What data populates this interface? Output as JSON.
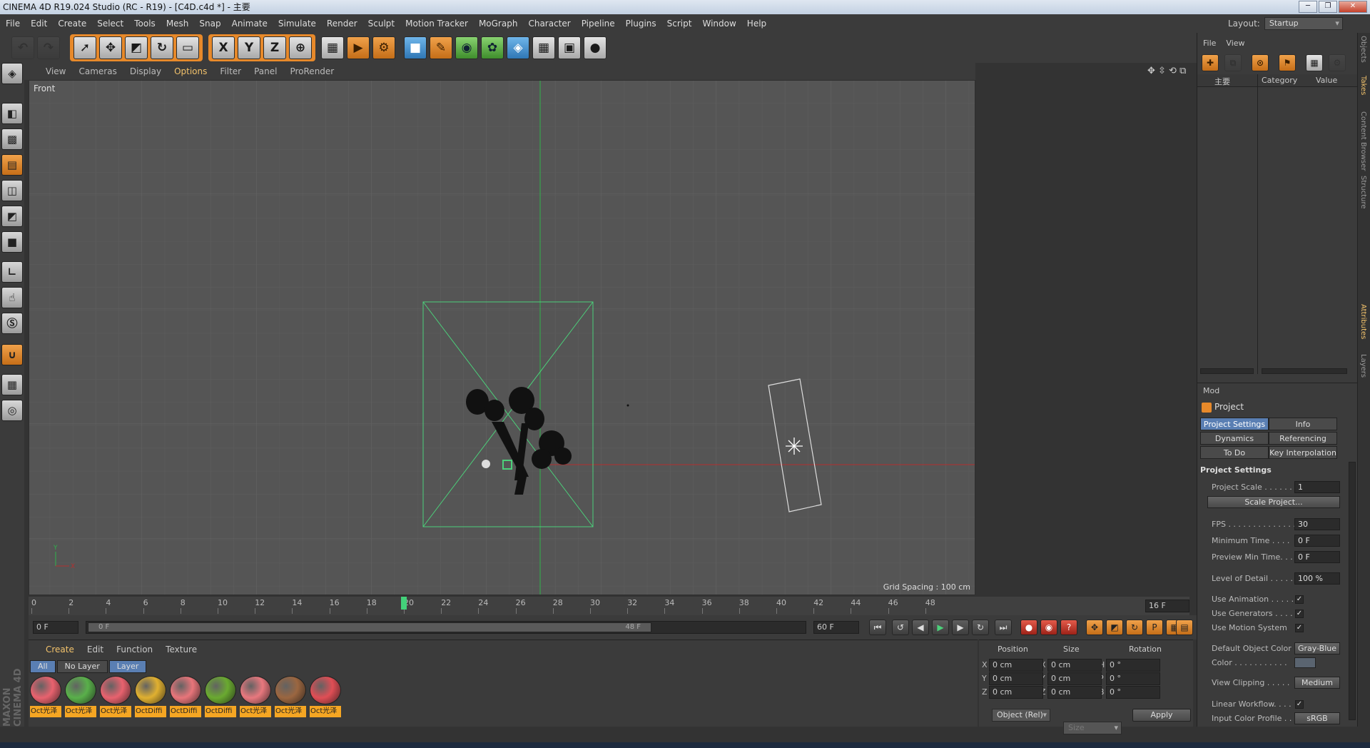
{
  "window": {
    "title": "CINEMA 4D R19.024 Studio (RC - R19) - [C4D.c4d *] - 主要"
  },
  "menu": [
    "File",
    "Edit",
    "Create",
    "Select",
    "Tools",
    "Mesh",
    "Snap",
    "Animate",
    "Simulate",
    "Render",
    "Sculpt",
    "Motion Tracker",
    "MoGraph",
    "Character",
    "Pipeline",
    "Plugins",
    "Script",
    "Window",
    "Help"
  ],
  "layout": {
    "label": "Layout:",
    "value": "Startup"
  },
  "toolbar": {
    "x_label": "X",
    "y_label": "Y",
    "z_label": "Z"
  },
  "viewport_menu": [
    "View",
    "Cameras",
    "Display",
    "Options",
    "Filter",
    "Panel",
    "ProRender"
  ],
  "viewport_active_menu": "Options",
  "viewport": {
    "name": "Front",
    "grid_spacing": "Grid Spacing : 100 cm"
  },
  "timeline": {
    "ticks": [
      "0",
      "2",
      "4",
      "6",
      "8",
      "10",
      "12",
      "14",
      "16",
      "18",
      "20",
      "22",
      "24",
      "26",
      "28",
      "30",
      "32",
      "34",
      "36",
      "38",
      "40",
      "42",
      "44",
      "46",
      "48"
    ],
    "current_frame": "16 F"
  },
  "transport": {
    "start": "0 F",
    "range_start": "0 F",
    "range_end": "48 F",
    "end": "60 F"
  },
  "material_manager": {
    "menu": [
      "Create",
      "Edit",
      "Function",
      "Texture"
    ],
    "filters": [
      "All",
      "No Layer",
      "Layer"
    ],
    "materials": [
      {
        "label": "Oct光泽",
        "color": "#e8626e"
      },
      {
        "label": "Oct光泽",
        "color": "#59b04a"
      },
      {
        "label": "Oct光泽",
        "color": "#e8626e"
      },
      {
        "label": "OctDiffi",
        "color": "#e0b030"
      },
      {
        "label": "OctDiffi",
        "color": "#e8757a"
      },
      {
        "label": "OctDiffi",
        "color": "#6aaa30"
      },
      {
        "label": "Oct光泽",
        "color": "#e8787e"
      },
      {
        "label": "Oct光泽",
        "color": "#9b6640"
      },
      {
        "label": "Oct光泽",
        "color": "#e04e55"
      }
    ]
  },
  "coordinates": {
    "headers": [
      "Position",
      "Size",
      "Rotation"
    ],
    "rows": [
      {
        "ax": "X",
        "pos": "0 cm",
        "sax": "X",
        "size": "0 cm",
        "rax": "H",
        "rot": "0 °"
      },
      {
        "ax": "Y",
        "pos": "0 cm",
        "sax": "Y",
        "size": "0 cm",
        "rax": "P",
        "rot": "0 °"
      },
      {
        "ax": "Z",
        "pos": "0 cm",
        "sax": "Z",
        "size": "0 cm",
        "rax": "B",
        "rot": "0 °"
      }
    ],
    "mode": "Object (Rel)",
    "size_mode": "Size",
    "apply": "Apply"
  },
  "object_manager": {
    "menu": [
      "File",
      "View"
    ],
    "columns": [
      "主要",
      "Category",
      "Value"
    ]
  },
  "attributes": {
    "mode": "Mod",
    "object": "Project",
    "tabs": [
      "Project Settings",
      "Info",
      "Dynamics",
      "Referencing",
      "To Do",
      "Key Interpolation"
    ],
    "section": "Project Settings",
    "project_scale": {
      "label": "Project Scale . . . . . .",
      "value": "1"
    },
    "scale_button": "Scale Project...",
    "fps": {
      "label": "FPS . . . . . . . . . . . . . . .",
      "value": "30"
    },
    "min_time": {
      "label": "Minimum Time . . . .",
      "value": "0 F"
    },
    "preview_min": {
      "label": "Preview Min Time. . .",
      "value": "0 F"
    },
    "lod": {
      "label": "Level of Detail . . . . .",
      "value": "100 %"
    },
    "use_animation": {
      "label": "Use Animation . . . . .",
      "check": "✓"
    },
    "use_generators": {
      "label": "Use Generators . . . .",
      "check": "✓"
    },
    "use_motion": {
      "label": "Use Motion System",
      "check": "✓"
    },
    "default_color": {
      "label": "Default Object Color",
      "value": "Gray-Blue"
    },
    "color": {
      "label": "Color . . . . . . . . . . ."
    },
    "view_clipping": {
      "label": "View Clipping . . . . .",
      "value": "Medium"
    },
    "linear_workflow": {
      "label": "Linear Workflow. . . .",
      "check": "✓"
    },
    "input_profile": {
      "label": "Input Color Profile . .",
      "value": "sRGB"
    }
  },
  "side_tabs": [
    "Objects",
    "Takes",
    "Content Browser",
    "Structure",
    "Attributes",
    "Layers"
  ],
  "brand": "MAXON CINEMA 4D"
}
